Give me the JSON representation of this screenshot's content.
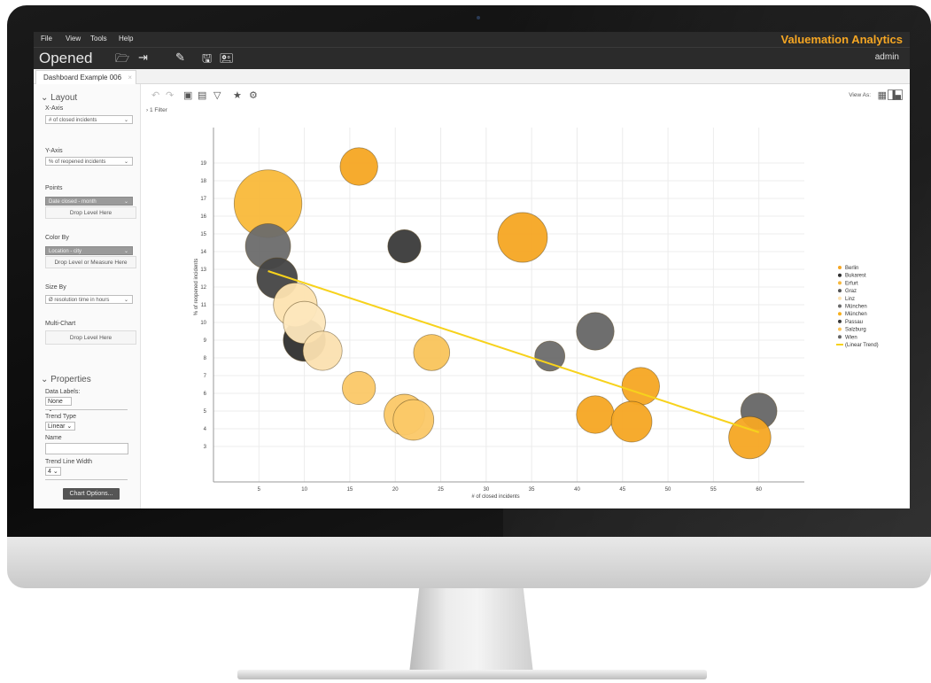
{
  "menu": {
    "items": [
      "File",
      "View",
      "Tools",
      "Help"
    ],
    "brand": "Valuemation Analytics"
  },
  "toolbar": {
    "opened": "Opened",
    "user": "admin",
    "tab_label": "Dashboard Example 006",
    "tab_close": "×"
  },
  "icons": {
    "folder": "folder-open-icon",
    "export": "export-icon",
    "edit": "pencil-icon",
    "save": "save-icon",
    "save_as": "save-as-icon",
    "undo": "undo-icon",
    "redo": "redo-icon",
    "layout_a": "panel-layout-icon",
    "layout_b": "grid-layout-icon",
    "filter": "filter-icon",
    "drill": "drill-icon",
    "settings": "gear-icon",
    "table_view": "table-view-icon",
    "chart_view": "chart-view-icon"
  },
  "left_panel": {
    "layout_title": "Layout",
    "x_axis_label": "X-Axis",
    "x_axis_value": "# of closed incidents",
    "y_axis_label": "Y-Axis",
    "y_axis_value": "% of reopened incidents",
    "points_label": "Points",
    "points_value": "Date closed - month",
    "points_drop": "Drop Level Here",
    "color_by_label": "Color By",
    "color_by_value": "Location - city",
    "color_by_drop": "Drop Level or Measure Here",
    "size_by_label": "Size By",
    "size_by_value": "Ø resolution time in hours",
    "multichart_label": "Multi-Chart",
    "multichart_drop": "Drop Level Here",
    "properties_title": "Properties",
    "data_labels_label": "Data Labels:",
    "data_labels_value": "None",
    "trend_type_label": "Trend Type",
    "trend_type_value": "Linear",
    "name_label": "Name",
    "trend_width_label": "Trend Line Width",
    "trend_width_value": "4",
    "chart_options_button": "Chart Options..."
  },
  "main": {
    "view_as": "View As:",
    "filter": "1 Filter"
  },
  "colors": {
    "Berlin": "#f5a623",
    "Bukarest": "#2f2f2f",
    "Erfurt": "#f6b83d",
    "Graz": "#555555",
    "Linz": "#fde3b0",
    "München": "#6b6b6b",
    "München2": "#f7b01e",
    "Passau": "#3a3a3a",
    "Salzburg": "#f9c45b",
    "Wien": "#666666",
    "trend": "#f7d21c"
  },
  "chart_data": {
    "type": "scatter",
    "xlabel": "# of closed incidents",
    "ylabel": "% of reopened incidents",
    "xlim": [
      0,
      65
    ],
    "ylim": [
      1,
      21
    ],
    "x_ticks": [
      5,
      10,
      15,
      20,
      25,
      30,
      35,
      40,
      45,
      50,
      55,
      60
    ],
    "y_ticks": [
      3,
      4,
      5,
      6,
      7,
      8,
      9,
      10,
      11,
      12,
      13,
      14,
      15,
      16,
      17,
      18,
      19
    ],
    "grid": true,
    "legend_placement": "right",
    "legend": [
      "Berlin",
      "Bukarest",
      "Erfurt",
      "Graz",
      "Linz",
      "München",
      "München",
      "Passau",
      "Salzburg",
      "Wien",
      "(Linear Trend)"
    ],
    "points": [
      {
        "x": 6,
        "y": 16.7,
        "size": 4.5,
        "color": "#f9b93a"
      },
      {
        "x": 16,
        "y": 18.8,
        "size": 2.5,
        "color": "#f5a623"
      },
      {
        "x": 21,
        "y": 14.3,
        "size": 2.2,
        "color": "#3a3a3a"
      },
      {
        "x": 34,
        "y": 14.8,
        "size": 3.3,
        "color": "#f5a623"
      },
      {
        "x": 6,
        "y": 14.3,
        "size": 3.0,
        "color": "#6b6b6b"
      },
      {
        "x": 7,
        "y": 12.5,
        "size": 2.7,
        "color": "#444444"
      },
      {
        "x": 10,
        "y": 9.0,
        "size": 2.8,
        "color": "#2f2f2f"
      },
      {
        "x": 9,
        "y": 11.0,
        "size": 2.9,
        "color": "#fde3b0"
      },
      {
        "x": 10,
        "y": 10.0,
        "size": 2.8,
        "color": "#fde7bd"
      },
      {
        "x": 12,
        "y": 8.4,
        "size": 2.6,
        "color": "#fbe0b0"
      },
      {
        "x": 16,
        "y": 6.3,
        "size": 2.2,
        "color": "#fbc867"
      },
      {
        "x": 24,
        "y": 8.3,
        "size": 2.4,
        "color": "#f9c45b"
      },
      {
        "x": 21,
        "y": 4.8,
        "size": 2.7,
        "color": "#fbc867"
      },
      {
        "x": 22,
        "y": 4.5,
        "size": 2.7,
        "color": "#fbc867"
      },
      {
        "x": 37,
        "y": 8.1,
        "size": 2.0,
        "color": "#6b6b6b"
      },
      {
        "x": 42,
        "y": 9.5,
        "size": 2.5,
        "color": "#666666"
      },
      {
        "x": 42,
        "y": 4.8,
        "size": 2.5,
        "color": "#f5a623"
      },
      {
        "x": 47,
        "y": 6.4,
        "size": 2.5,
        "color": "#f5a623"
      },
      {
        "x": 46,
        "y": 4.4,
        "size": 2.7,
        "color": "#f5a623"
      },
      {
        "x": 60,
        "y": 5.0,
        "size": 2.4,
        "color": "#666666"
      },
      {
        "x": 59,
        "y": 3.5,
        "size": 2.8,
        "color": "#f5a623"
      }
    ],
    "trend": {
      "x1": 6,
      "y1": 12.9,
      "x2": 60,
      "y2": 3.8
    }
  }
}
